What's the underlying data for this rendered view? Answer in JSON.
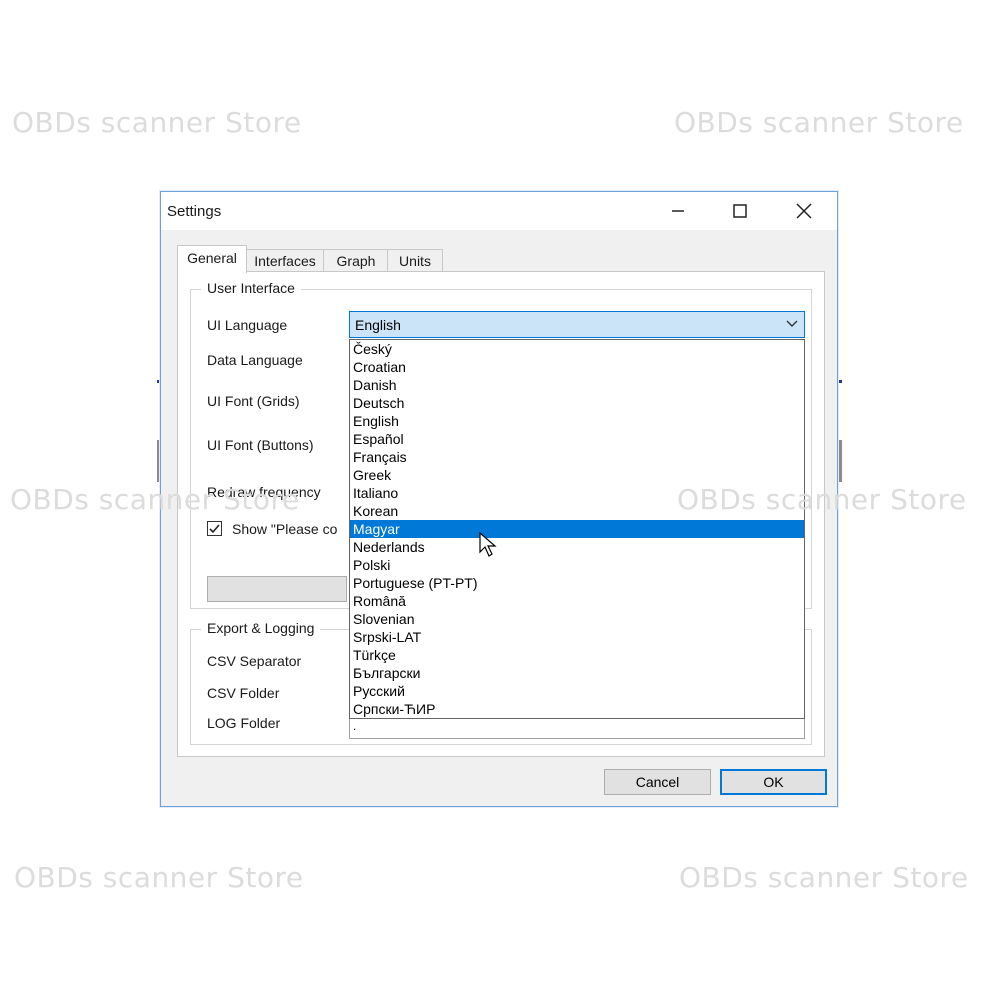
{
  "watermark": "OBDs scanner Store",
  "window": {
    "title": "Settings"
  },
  "tabs": [
    {
      "label": "General",
      "active": true
    },
    {
      "label": "Interfaces",
      "active": false
    },
    {
      "label": "Graph",
      "active": false
    },
    {
      "label": "Units",
      "active": false
    }
  ],
  "user_interface": {
    "group_title": "User Interface",
    "ui_language_label": "UI Language",
    "ui_language_value": "English",
    "data_language_label": "Data Language",
    "ui_font_grids_label": "UI Font (Grids)",
    "ui_font_buttons_label": "UI Font (Buttons)",
    "redraw_frequency_label": "Redraw frequency",
    "show_checkbox_label": "Show \"Please co",
    "show_checkbox_checked": true
  },
  "language_dropdown": {
    "options": [
      "Český",
      "Croatian",
      "Danish",
      "Deutsch",
      "English",
      "Español",
      "Français",
      "Greek",
      "Italiano",
      "Korean",
      "Magyar",
      "Nederlands",
      "Polski",
      "Portuguese (PT-PT)",
      "Română",
      "Slovenian",
      "Srpski-LAT",
      "Türkçe",
      "Български",
      "Русский",
      "Српски-ЋИР"
    ],
    "highlighted": "Magyar"
  },
  "export_logging": {
    "group_title": "Export & Logging",
    "csv_separator_label": "CSV Separator",
    "csv_folder_label": "CSV Folder",
    "log_folder_label": "LOG Folder",
    "log_folder_value": "."
  },
  "buttons": {
    "cancel": "Cancel",
    "ok": "OK"
  },
  "colors": {
    "accent": "#0078d7",
    "combo_bg": "#cce4f7",
    "window_border": "#6f9fd8"
  }
}
